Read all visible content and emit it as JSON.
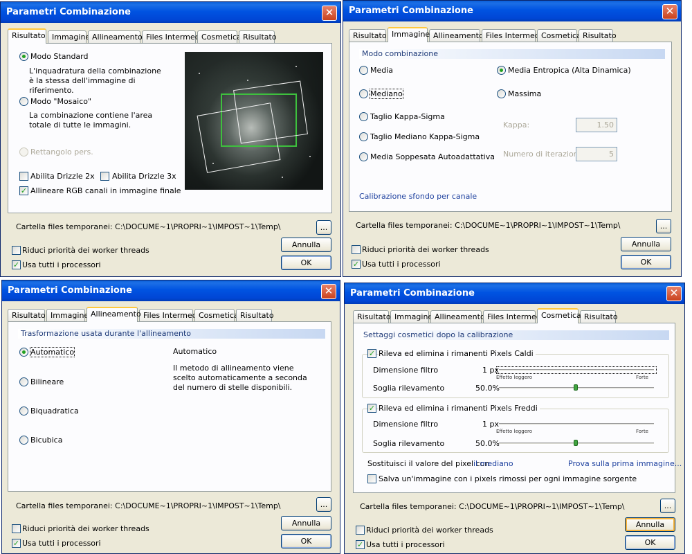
{
  "title": "Parametri Combinazione",
  "close_glyph": "✕",
  "tabs": [
    "Risultato",
    "Immagine",
    "Allineamento",
    "Files Intermedi",
    "Cosmetica",
    "Risultato"
  ],
  "footer": {
    "temp_label": "Cartella files temporanei:",
    "temp_path": "C:\\DOCUME~1\\PROPRI~1\\IMPOST~1\\Temp\\",
    "browse": "...",
    "reduce_priority": "Riduci priorità dei worker threads",
    "use_all_cpus": "Usa tutti i processori",
    "cancel": "Annulla",
    "ok": "OK"
  },
  "d1": {
    "modo_standard": "Modo Standard",
    "modo_standard_desc": "L'inquadratura della combinazione è la stessa dell'immagine di riferimento.",
    "modo_mosaico": "Modo \"Mosaico\"",
    "modo_mosaico_desc": "La combinazione contiene l'area totale di tutte le immagini.",
    "rettangolo": "Rettangolo pers.",
    "drizzle2": "Abilita Drizzle 2x",
    "drizzle3": "Abilita Drizzle 3x",
    "allineare_rgb": "Allineare RGB canali in immagine finale"
  },
  "d2": {
    "section": "Modo combinazione",
    "media": "Media",
    "mediano": "Mediano",
    "kappa_sigma": "Taglio Kappa-Sigma",
    "mediano_kappa_sigma": "Taglio Mediano Kappa-Sigma",
    "soppesata": "Media Soppesata Autoadattativa",
    "entropica": "Media Entropica (Alta Dinamica)",
    "massima": "Massima",
    "kappa_label": "Kappa:",
    "kappa_value": "1.50",
    "iter_label": "Numero di iterazioni:",
    "iter_value": "5",
    "calibrazione": "Calibrazione sfondo per canale"
  },
  "d3": {
    "section": "Trasformazione usata durante l'allineamento",
    "automatico": "Automatico",
    "bilineare": "Bilineare",
    "biquadratica": "Biquadratica",
    "bicubica": "Bicubica",
    "desc_title": "Automatico",
    "desc_text": "Il metodo di allineamento viene scelto automaticamente a seconda del numero di stelle disponibili."
  },
  "d4": {
    "section": "Settaggi cosmetici dopo la calibrazione",
    "caldi": "Rileva ed elimina i rimanenti Pixels Caldi",
    "freddi": "Rileva ed elimina i rimanenti Pixels Freddi",
    "dimensione": "Dimensione filtro",
    "dimensione_value": "1 px",
    "soglia": "Soglia rilevamento",
    "soglia_value": "50.0%",
    "effetto": "Effetto leggero",
    "forte": "Forte",
    "sostituisci": "Sostituisci il valore del pixel con",
    "mediano_link": "il mediano",
    "prova": "Prova sulla prima immagine...",
    "salva": "Salva un'immagine con i pixels rimossi per ogni immagine sorgente"
  },
  "state": {
    "checkmark": "✓",
    "soglia_fraction": 0.5
  }
}
